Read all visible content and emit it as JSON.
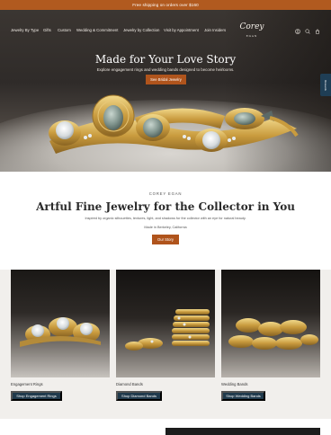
{
  "announcement": {
    "text": "Free shipping on orders over $160"
  },
  "nav": {
    "items": [
      {
        "label": "Jewelry By Type",
        "name": "nav-item-jewelry-by-type"
      },
      {
        "label": "Gifts",
        "name": "nav-item-gifts"
      },
      {
        "label": "Custom",
        "name": "nav-item-custom"
      },
      {
        "label": "Wedding & Commitment",
        "name": "nav-item-wedding-commitment"
      },
      {
        "label": "Jewelry by Collection",
        "name": "nav-item-jewelry-by-collection"
      },
      {
        "label": "Visit by Appointment",
        "name": "nav-item-visit-by-appointment"
      },
      {
        "label": "Join Insiders",
        "name": "nav-item-join-insiders"
      }
    ],
    "logo": {
      "main": "Corey",
      "sub": "EGAN"
    },
    "icons": [
      "account-icon",
      "search-icon",
      "cart-icon"
    ]
  },
  "hero": {
    "title": "Made for Your Love Story",
    "subtitle": "Explore engagement rings and wedding bands designed to become heirlooms.",
    "button": "See Bridal Jewelry"
  },
  "rewards_tab": {
    "label": "Rewards"
  },
  "brand": {
    "eyebrow": "COREY EGAN",
    "title": "Artful Fine Jewelry for the Collector in You",
    "subtitle": "Inspired by organic silhouettes, textures, light, and shadows for the collector with an eye for natural beauty.",
    "location": "Made in Berkeley, California",
    "button": "Our Story"
  },
  "cards": [
    {
      "label": "Engagement Rings",
      "button": "Shop Engagement Rings"
    },
    {
      "label": "Diamond Bands",
      "button": "Shop Diamond Bands"
    },
    {
      "label": "Wedding Bands",
      "button": "Shop Wedding Bands"
    }
  ],
  "colors": {
    "announcement": "#b15a1f",
    "button_primary": "#b0541c",
    "button_secondary": "#203a4c",
    "rewards": "#1f3e55",
    "gold": "#c9a14a"
  }
}
